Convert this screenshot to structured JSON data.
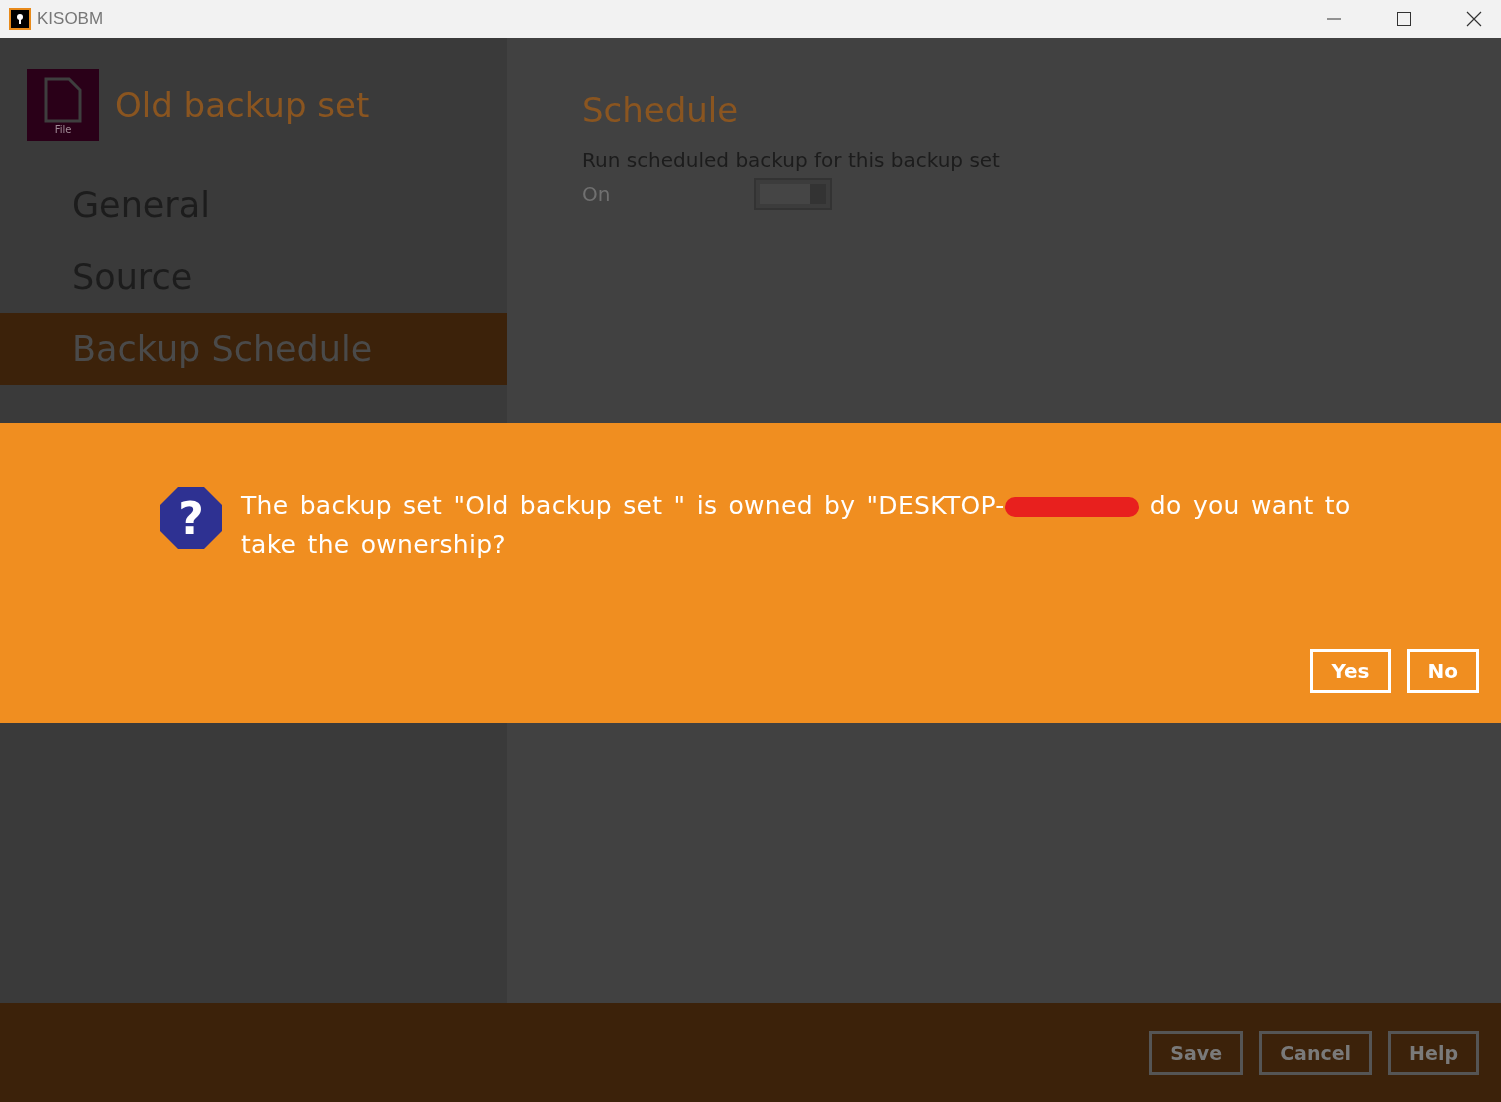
{
  "window": {
    "title": "KISOBM"
  },
  "backup_set": {
    "name": "Old backup set",
    "icon_caption": "File"
  },
  "sidebar": {
    "items": [
      {
        "label": "General",
        "selected": false
      },
      {
        "label": "Source",
        "selected": false
      },
      {
        "label": "Backup Schedule",
        "selected": true
      }
    ]
  },
  "schedule": {
    "title": "Schedule",
    "label": "Run scheduled backup for this backup set",
    "toggle": {
      "label": "On",
      "on": true
    }
  },
  "dialog": {
    "icon_glyph": "?",
    "message_before": "The backup set \"Old backup set \" is owned by \"DESKTOP-",
    "redacted": true,
    "message_after": "do you want to take the ownership?",
    "buttons": [
      "Yes",
      "No"
    ]
  },
  "footer": {
    "buttons": [
      "Save",
      "Cancel",
      "Help"
    ]
  }
}
